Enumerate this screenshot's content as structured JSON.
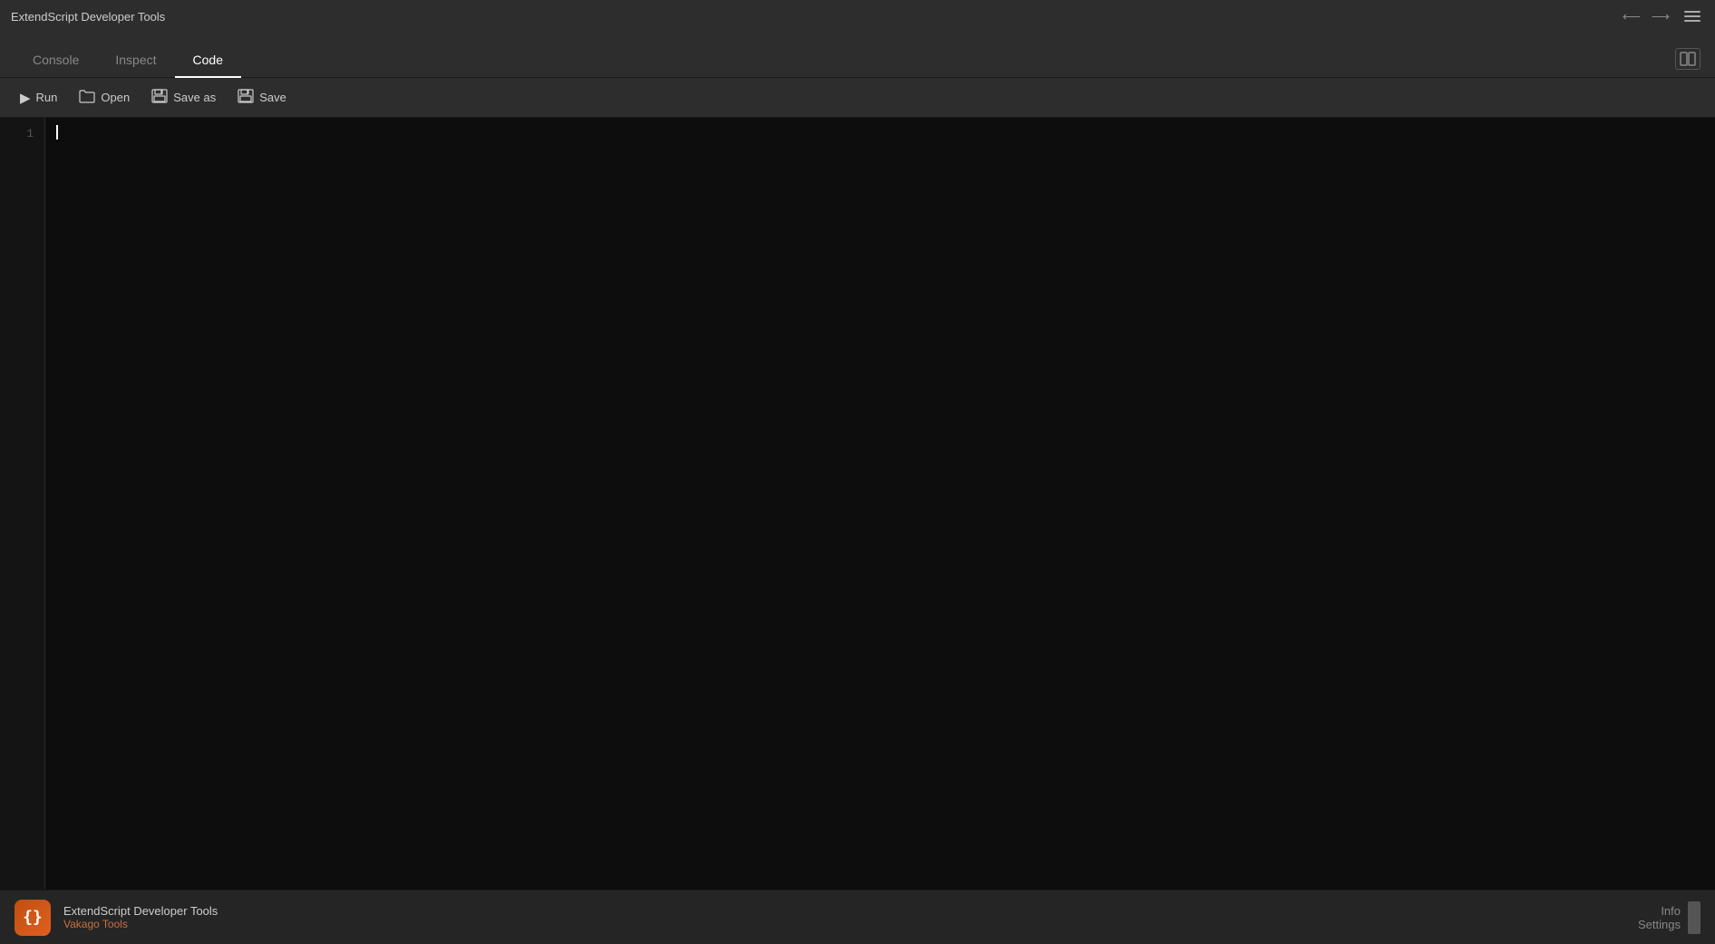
{
  "titleBar": {
    "title": "ExtendScript Developer Tools",
    "controls": {
      "minimize": "←",
      "restore": "→",
      "hamburger": "≡"
    }
  },
  "tabs": {
    "items": [
      {
        "label": "Console",
        "active": false
      },
      {
        "label": "Inspect",
        "active": false
      },
      {
        "label": "Code",
        "active": true
      }
    ],
    "splitViewIcon": "⊟"
  },
  "toolbar": {
    "buttons": [
      {
        "label": "Run",
        "icon": "▶"
      },
      {
        "label": "Open",
        "icon": "📂"
      },
      {
        "label": "Save as",
        "icon": "💾"
      },
      {
        "label": "Save",
        "icon": "🖫"
      }
    ]
  },
  "editor": {
    "lineNumbers": [
      1
    ],
    "content": ""
  },
  "statusBar": {
    "logo": "{}",
    "appName": "ExtendScript Developer Tools",
    "author": "Vakago Tools",
    "info": "Info",
    "settings": "Settings"
  }
}
